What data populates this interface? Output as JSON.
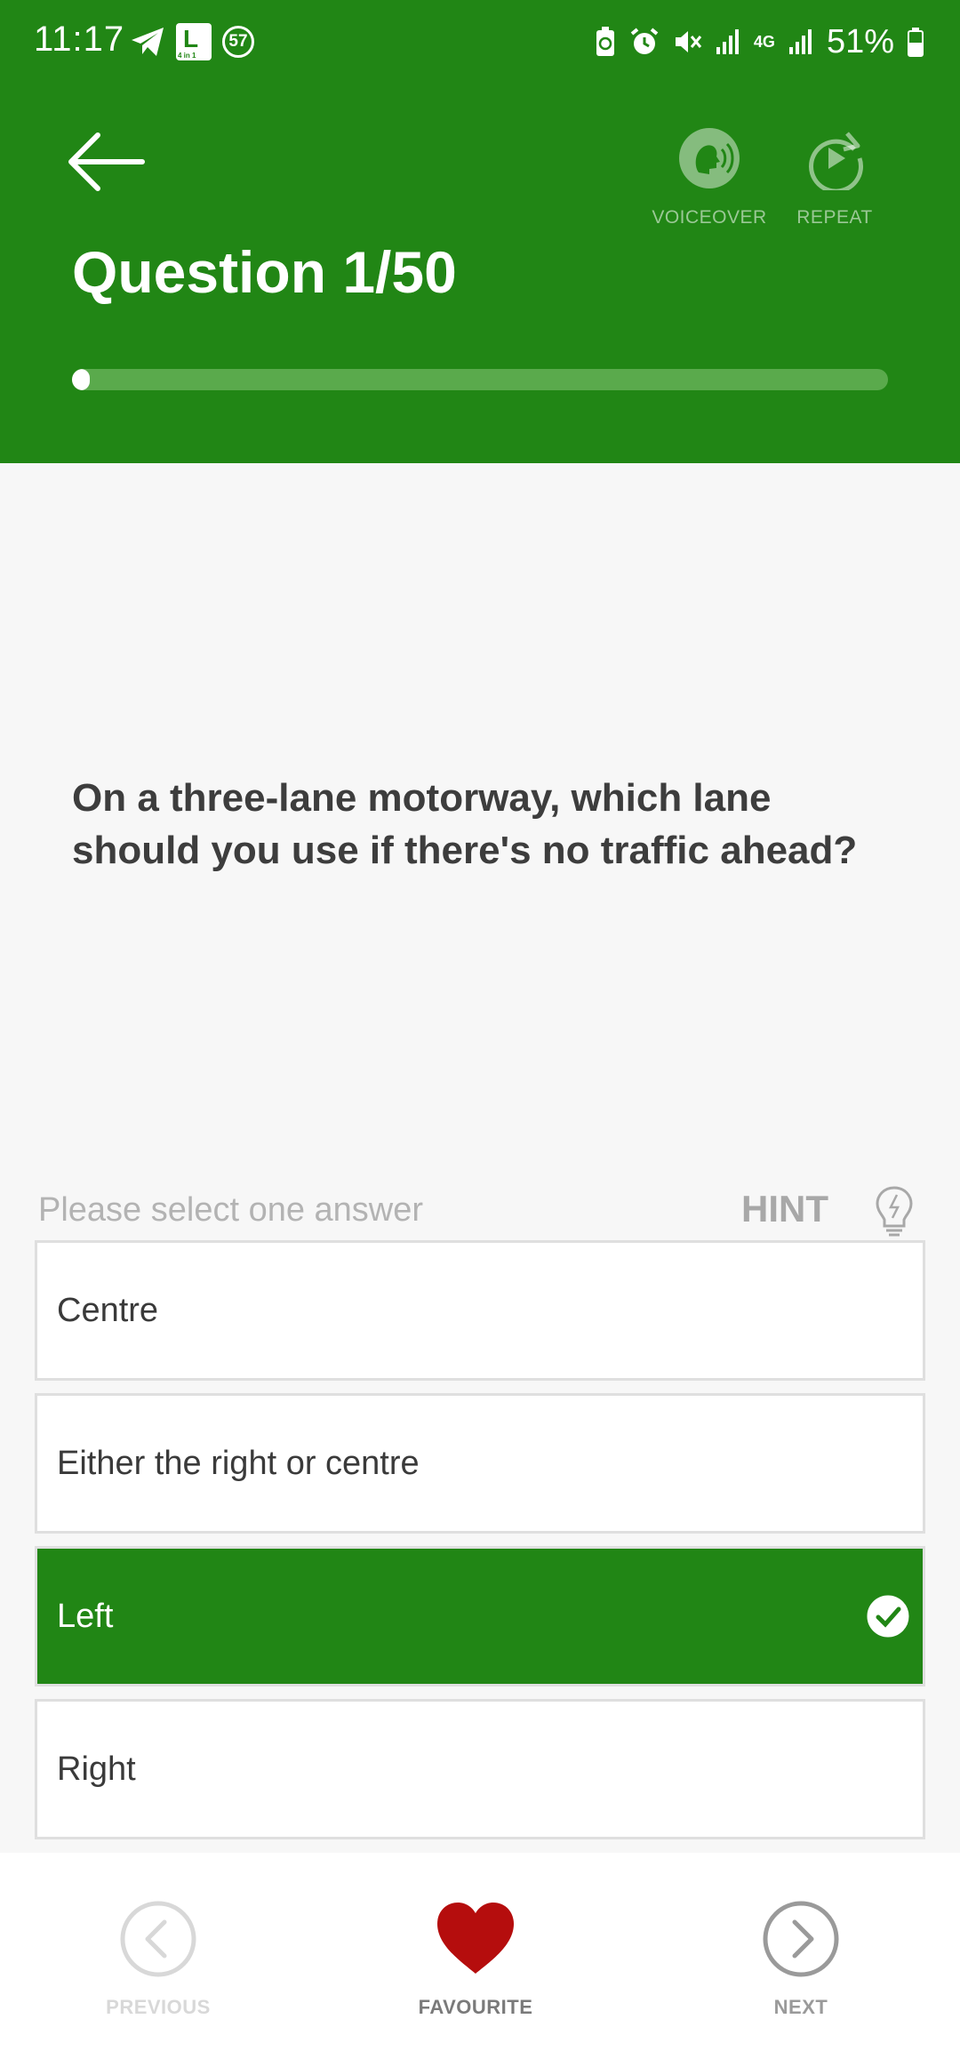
{
  "status_bar": {
    "time": "11:17",
    "notification_badge": "57",
    "app_plate_letter": "L",
    "app_plate_sub": "4 in 1",
    "network": "4G",
    "battery": "51%"
  },
  "header": {
    "title": "Question 1/50",
    "progress_fraction": 0.02,
    "voiceover_label": "VOICEOVER",
    "repeat_label": "REPEAT"
  },
  "question": {
    "text": "On a three-lane motorway, which lane should you use if there's no traffic ahead?"
  },
  "prompt": {
    "text": "Please select one answer",
    "hint_label": "HINT"
  },
  "answers": [
    {
      "label": "Centre",
      "selected": false
    },
    {
      "label": "Either the right or centre",
      "selected": false
    },
    {
      "label": "Left",
      "selected": true
    },
    {
      "label": "Right",
      "selected": false
    }
  ],
  "bottom_nav": {
    "previous_label": "PREVIOUS",
    "favourite_label": "FAVOURITE",
    "next_label": "NEXT"
  },
  "colors": {
    "primary_green": "#218615",
    "favourite_red": "#b50d0d"
  }
}
